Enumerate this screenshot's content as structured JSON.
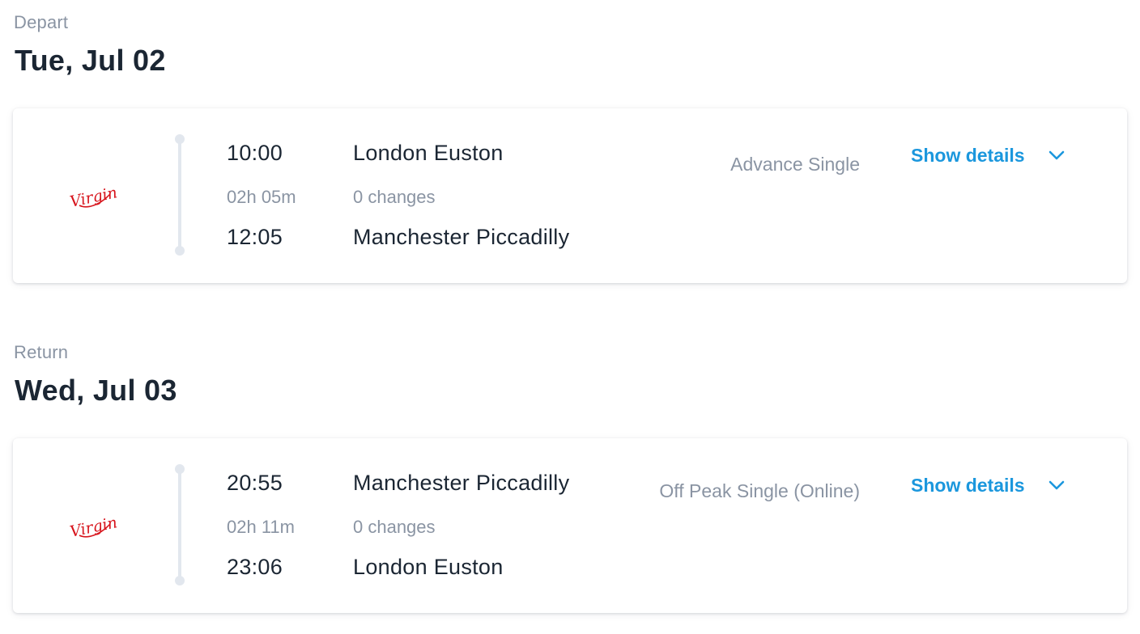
{
  "journeys": [
    {
      "label": "Depart",
      "date": "Tue, Jul 02",
      "operator_logo": "Virgin",
      "departure_time": "10:00",
      "duration": "02h 05m",
      "arrival_time": "12:05",
      "origin": "London Euston",
      "changes": "0 changes",
      "destination": "Manchester Piccadilly",
      "fare_type": "Advance Single",
      "details_label": "Show details"
    },
    {
      "label": "Return",
      "date": "Wed, Jul 03",
      "operator_logo": "Virgin",
      "departure_time": "20:55",
      "duration": "02h 11m",
      "arrival_time": "23:06",
      "origin": "Manchester Piccadilly",
      "changes": "0 changes",
      "destination": "London Euston",
      "fare_type": "Off Peak Single (Online)",
      "details_label": "Show details"
    }
  ],
  "colors": {
    "accent": "#1b97dd",
    "brand_logo": "#d7141c",
    "muted_text": "#8a94a3",
    "primary_text": "#1b2633",
    "timeline": "#e2e7ee"
  },
  "icons": {
    "logo": "virgin-trains-logo",
    "toggle": "chevron-down-icon"
  }
}
